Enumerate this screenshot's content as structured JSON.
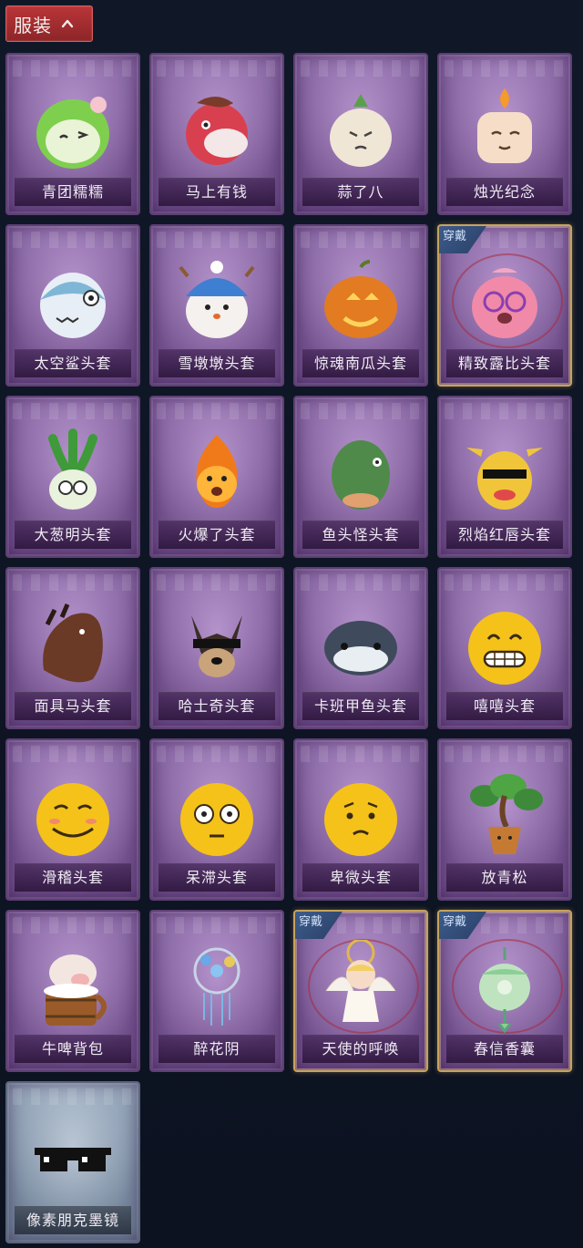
{
  "header": {
    "title": "服装",
    "chevron_icon": "chevron-up-icon"
  },
  "badge_label": "穿戴",
  "items": [
    {
      "name": "青团糯糯",
      "icon": "green-dumpling-icon",
      "equipped": false
    },
    {
      "name": "马上有钱",
      "icon": "red-horse-icon",
      "equipped": false
    },
    {
      "name": "蒜了八",
      "icon": "garlic-icon",
      "equipped": false
    },
    {
      "name": "烛光纪念",
      "icon": "candle-icon",
      "equipped": false
    },
    {
      "name": "太空鲨头套",
      "icon": "shark-head-icon",
      "equipped": false
    },
    {
      "name": "雪墩墩头套",
      "icon": "snowman-head-icon",
      "equipped": false
    },
    {
      "name": "惊魂南瓜头套",
      "icon": "pumpkin-head-icon",
      "equipped": false
    },
    {
      "name": "精致露比头套",
      "icon": "pink-beaver-head-icon",
      "equipped": true
    },
    {
      "name": "大葱明头套",
      "icon": "scallion-head-icon",
      "equipped": false
    },
    {
      "name": "火爆了头套",
      "icon": "fire-head-icon",
      "equipped": false
    },
    {
      "name": "鱼头怪头套",
      "icon": "fish-head-icon",
      "equipped": false
    },
    {
      "name": "烈焰红唇头套",
      "icon": "pikachu-head-icon",
      "equipped": false
    },
    {
      "name": "面具马头套",
      "icon": "horse-mask-icon",
      "equipped": false
    },
    {
      "name": "哈士奇头套",
      "icon": "husky-head-icon",
      "equipped": false
    },
    {
      "name": "卡班甲鱼头套",
      "icon": "turtle-head-icon",
      "equipped": false
    },
    {
      "name": "嘻嘻头套",
      "icon": "grin-emoji-icon",
      "equipped": false
    },
    {
      "name": "滑稽头套",
      "icon": "funny-emoji-icon",
      "equipped": false
    },
    {
      "name": "呆滞头套",
      "icon": "dazed-emoji-icon",
      "equipped": false
    },
    {
      "name": "卑微头套",
      "icon": "humble-emoji-icon",
      "equipped": false
    },
    {
      "name": "放青松",
      "icon": "bonsai-pine-icon",
      "equipped": false
    },
    {
      "name": "牛啤背包",
      "icon": "cow-beer-backpack-icon",
      "equipped": false
    },
    {
      "name": "醉花阴",
      "icon": "floral-ornament-icon",
      "equipped": false
    },
    {
      "name": "天使的呼唤",
      "icon": "angel-icon",
      "equipped": true
    },
    {
      "name": "春信香囊",
      "icon": "sachet-icon",
      "equipped": true
    },
    {
      "name": "像素朋克墨镜",
      "icon": "pixel-sunglasses-icon",
      "equipped": false,
      "variant": "gray"
    }
  ],
  "colors": {
    "background": "#0e1424",
    "card_purple": "#7a5a96",
    "header_red": "#a52e31",
    "equipped_gold": "#c6a35d"
  }
}
